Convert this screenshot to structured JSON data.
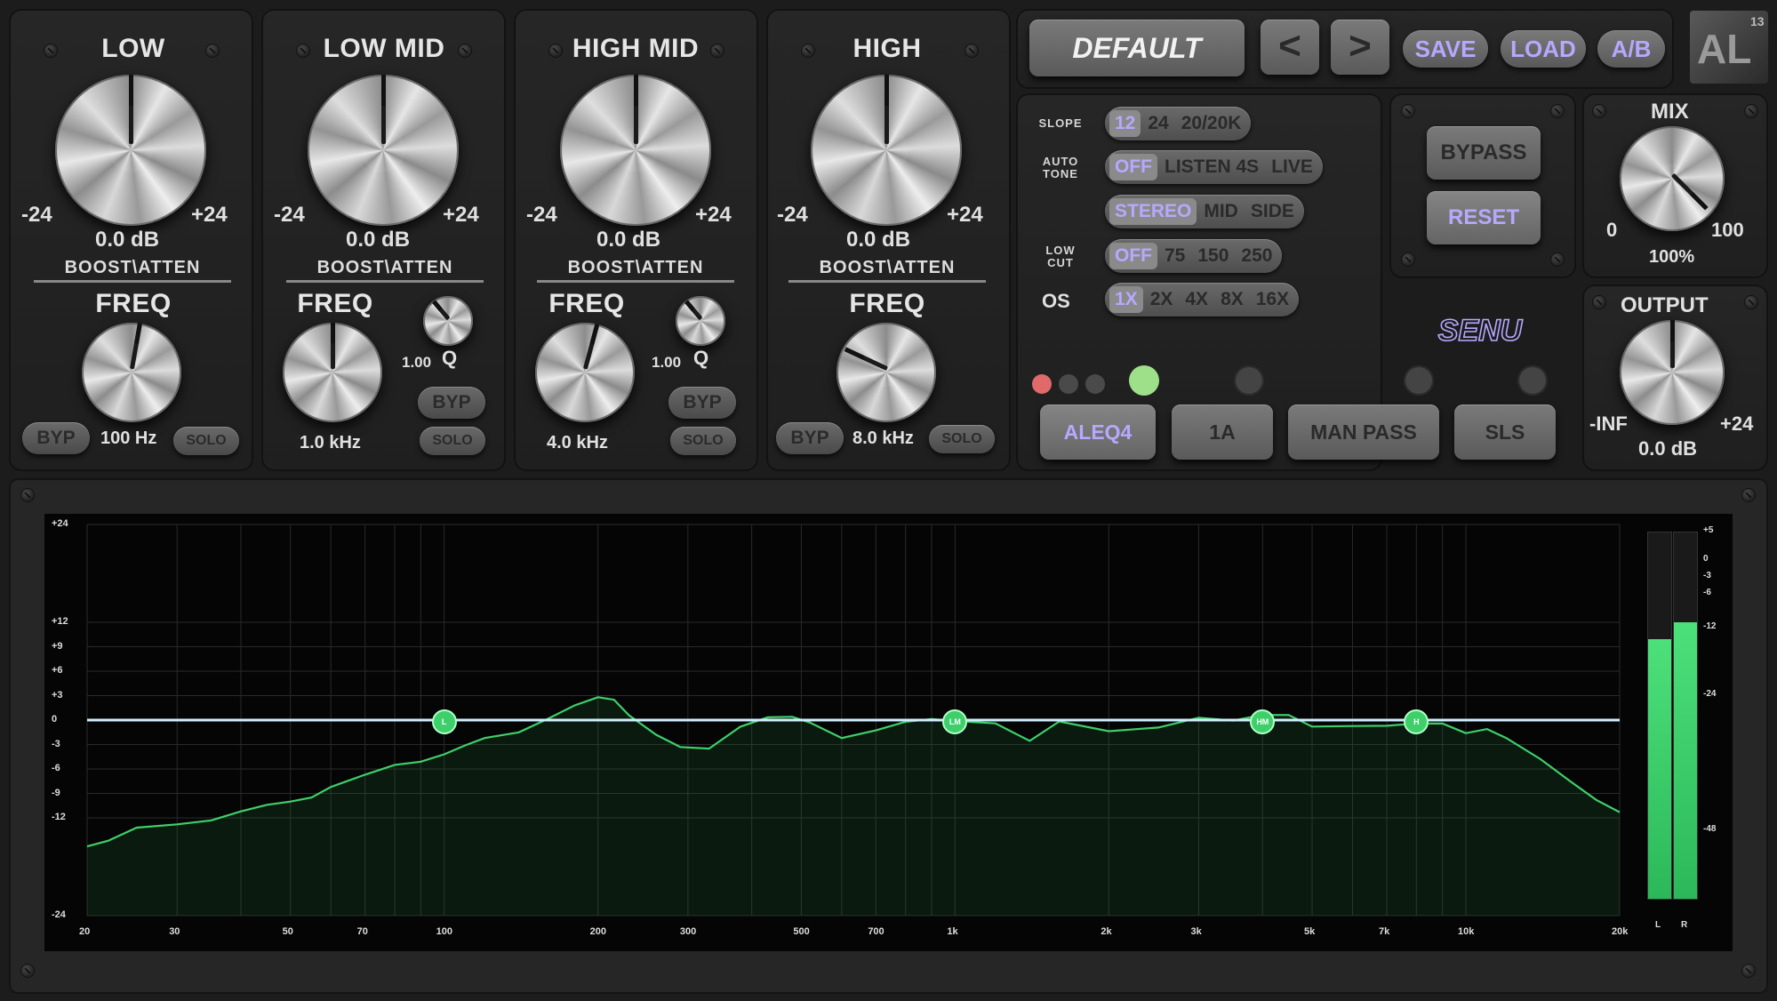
{
  "bands": [
    {
      "title": "LOW",
      "gain": "0.0 dB",
      "min": "-24",
      "max": "+24",
      "boost_label": "BOOST\\ATTEN",
      "freq_label": "FREQ",
      "freq_value": "100 Hz",
      "byp": "BYP",
      "solo": "SOLO"
    },
    {
      "title": "LOW MID",
      "gain": "0.0 dB",
      "min": "-24",
      "max": "+24",
      "boost_label": "BOOST\\ATTEN",
      "freq_label": "FREQ",
      "freq_value": "1.0 kHz",
      "q_value": "1.00",
      "q_label": "Q",
      "byp": "BYP",
      "solo": "SOLO"
    },
    {
      "title": "HIGH MID",
      "gain": "0.0 dB",
      "min": "-24",
      "max": "+24",
      "boost_label": "BOOST\\ATTEN",
      "freq_label": "FREQ",
      "freq_value": "4.0 kHz",
      "q_value": "1.00",
      "q_label": "Q",
      "byp": "BYP",
      "solo": "SOLO"
    },
    {
      "title": "HIGH",
      "gain": "0.0 dB",
      "min": "-24",
      "max": "+24",
      "boost_label": "BOOST\\ATTEN",
      "freq_label": "FREQ",
      "freq_value": "8.0 kHz",
      "byp": "BYP",
      "solo": "SOLO"
    }
  ],
  "preset": {
    "name": "DEFAULT",
    "prev": "<",
    "next": ">",
    "save": "SAVE",
    "load": "LOAD",
    "ab": "A/B"
  },
  "logo": {
    "text": "AL",
    "version": "13"
  },
  "options": {
    "slope": {
      "label": "SLOPE",
      "items": [
        "12",
        "24",
        "20/20K"
      ],
      "selected": "12"
    },
    "auto_tone": {
      "label_1": "AUTO",
      "label_2": "TONE",
      "items": [
        "OFF",
        "LISTEN 4S",
        "LIVE"
      ],
      "selected": "OFF"
    },
    "stereo": {
      "items": [
        "STEREO",
        "MID",
        "SIDE"
      ],
      "selected": "STEREO"
    },
    "low_cut": {
      "label_1": "LOW",
      "label_2": "CUT",
      "items": [
        "OFF",
        "75",
        "150",
        "250"
      ],
      "selected": "OFF"
    },
    "os": {
      "label": "OS",
      "items": [
        "1X",
        "2X",
        "4X",
        "8X",
        "16X"
      ],
      "selected": "1X"
    }
  },
  "bypass": "BYPASS",
  "reset": "RESET",
  "mix": {
    "title": "MIX",
    "min": "0",
    "max": "100",
    "value": "100%"
  },
  "output": {
    "title": "OUTPUT",
    "min": "-INF",
    "max": "+24",
    "value": "0.0 dB"
  },
  "modes": {
    "items": [
      "ALEQ4",
      "1A",
      "MAN PASS",
      "SLS"
    ],
    "selected": "ALEQ4"
  },
  "brand": "SENU",
  "analyzer": {
    "y_labels": [
      "+24",
      "+12",
      "+9",
      "+6",
      "+3",
      "0",
      "-3",
      "-6",
      "-9",
      "-12",
      "-24"
    ],
    "x_labels": [
      "20",
      "30",
      "50",
      "70",
      "100",
      "200",
      "300",
      "500",
      "700",
      "1k",
      "2k",
      "3k",
      "5k",
      "7k",
      "10k",
      "20k"
    ],
    "nodes": [
      "L",
      "LM",
      "HM",
      "H"
    ],
    "meter_labels": [
      "+5",
      "0",
      "-3",
      "-6",
      "-12",
      "-24",
      "-48"
    ],
    "meter_channels": [
      "L",
      "R"
    ],
    "meter_levels": {
      "L": -14,
      "R": -11
    }
  },
  "colors": {
    "accent": "#b7a8ff",
    "curve": "#3ecf6a",
    "eq_line": "#cfeeff",
    "led_red": "#e06a6a",
    "led_green": "#9ee08a"
  }
}
